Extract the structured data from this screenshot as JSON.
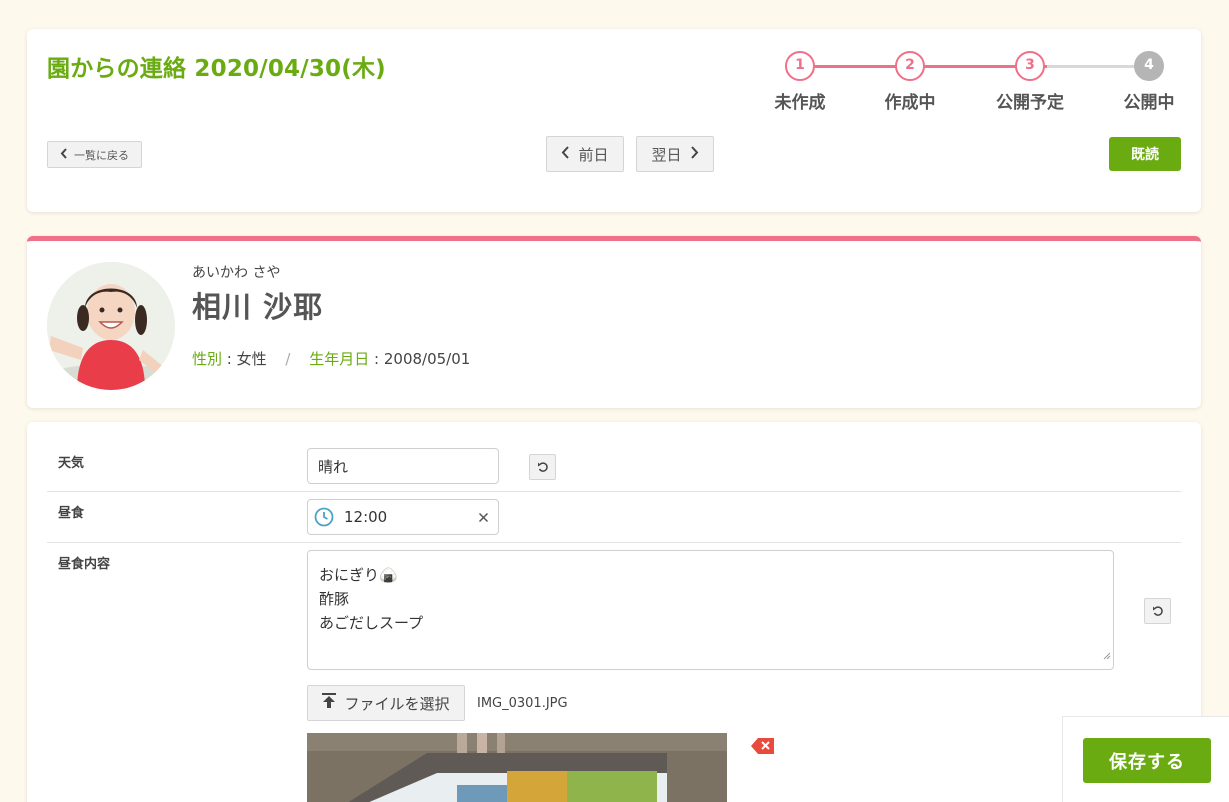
{
  "header": {
    "title": "園からの連絡 2020/04/30(木)",
    "steps": [
      {
        "number": "1",
        "label": "未作成",
        "state": "done"
      },
      {
        "number": "2",
        "label": "作成中",
        "state": "done"
      },
      {
        "number": "3",
        "label": "公開予定",
        "state": "current"
      },
      {
        "number": "4",
        "label": "公開中",
        "state": "todo"
      }
    ],
    "back_label": "一覧に戻る",
    "prev_label": "前日",
    "next_label": "翌日",
    "read_label": "既読"
  },
  "profile": {
    "kana": "あいかわ さや",
    "name": "相川 沙耶",
    "gender_key": "性別",
    "gender_value": "女性",
    "birth_key": "生年月日",
    "birth_value": "2008/05/01"
  },
  "form": {
    "weather_label": "天気",
    "weather_value": "晴れ",
    "lunch_label": "昼食",
    "lunch_time": "12:00",
    "lunch_content_label": "昼食内容",
    "lunch_content_lines": [
      "おにぎり🍙",
      "酢豚",
      "あごだしスープ"
    ],
    "file_button_label": "ファイルを選択",
    "file_name": "IMG_0301.JPG"
  },
  "footer": {
    "save_label": "保存する"
  },
  "colors": {
    "accent_green": "#6aab12",
    "accent_pink": "#ef7088",
    "step_todo": "#b5b5b5",
    "background": "#fdf9ec"
  }
}
